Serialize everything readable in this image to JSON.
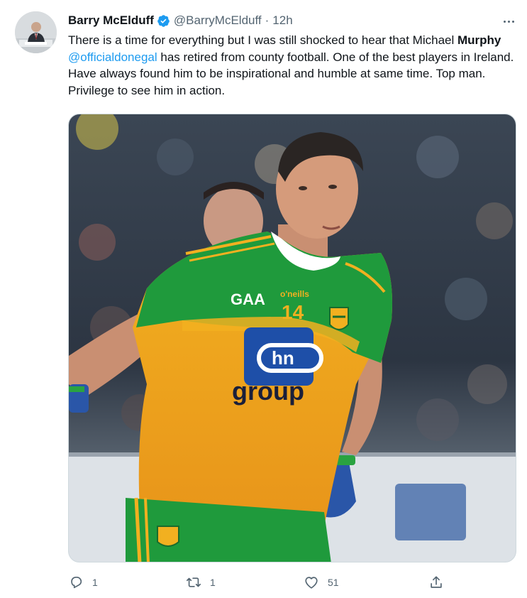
{
  "tweet": {
    "author": {
      "display_name": "Barry McElduff",
      "handle": "@BarryMcElduff",
      "separator": "·",
      "time": "12h",
      "verified": true
    },
    "body": {
      "part1": "There is a time for everything but I was still shocked to hear that Michael ",
      "bold": "Murphy",
      "space": " ",
      "mention": "@officialdonegal",
      "part2": " has retired from county football. One of the best players in Ireland. Have always found him to be inspirational and humble at same time. Top man. Privilege to see him in action."
    },
    "media": {
      "jersey_number": "14",
      "sponsor_logo": "hn",
      "sponsor_text": "group",
      "brand": "o'neills",
      "association_logo": "GAA"
    },
    "actions": {
      "reply_count": "1",
      "retweet_count": "1",
      "like_count": "51"
    }
  },
  "colors": {
    "accent": "#1d9bf0",
    "secondary_text": "#536471",
    "jersey_green": "#1f9a3c",
    "jersey_gold": "#f0a51e"
  },
  "icons": [
    "verified-icon",
    "more-icon",
    "reply-icon",
    "retweet-icon",
    "like-icon",
    "share-icon"
  ]
}
